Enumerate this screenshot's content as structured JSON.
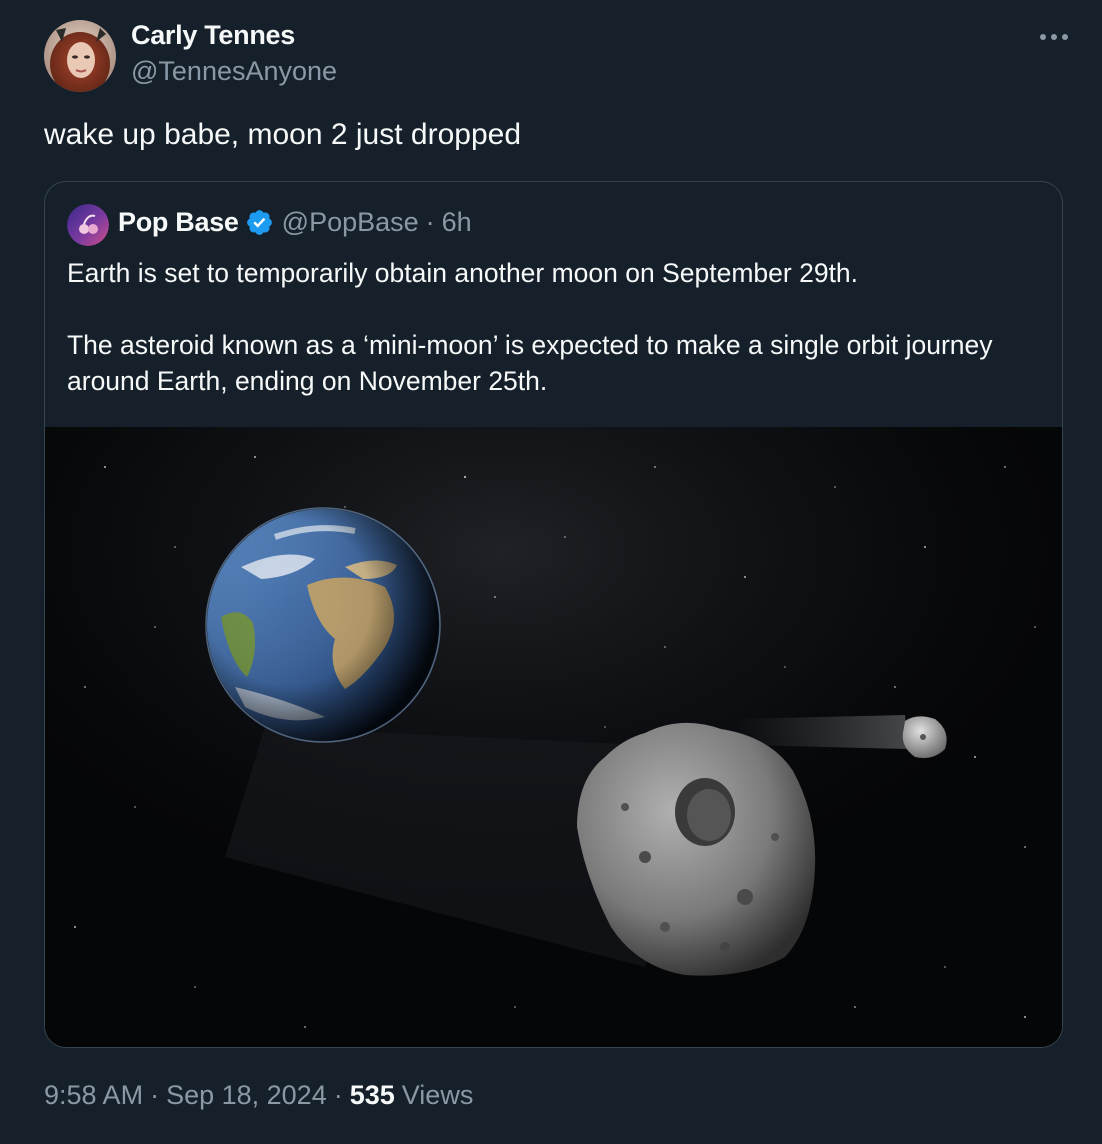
{
  "tweet": {
    "author_name": "Carly Tennes",
    "author_handle": "@TennesAnyone",
    "text": "wake up babe, moon 2 just dropped",
    "more_icon": "ellipsis-icon"
  },
  "quoted_tweet": {
    "author_name": "Pop Base",
    "author_handle": "@PopBase",
    "separator": "·",
    "time": "6h",
    "verified_icon": "verified-badge-icon",
    "paragraphs": [
      "Earth is set to temporarily obtain another moon on September 29th.",
      "The asteroid known as a ‘mini-moon’ is expected to make a single orbit journey around Earth, ending on November 25th."
    ],
    "image": {
      "subject": "earth-with-asteroids",
      "colors": {
        "space": "#050608",
        "ocean": "#2f5f9c",
        "land": "#b89d6b",
        "asteroid": "#8d8d8d"
      }
    }
  },
  "footer": {
    "time": "9:58 AM",
    "separator": "·",
    "date": "Sep 18, 2024",
    "views_count": "535",
    "views_label": "Views"
  },
  "theme": {
    "background": "#15202b",
    "text_primary": "#f7f9f9",
    "text_secondary": "#8b98a5",
    "border": "#38444d",
    "verified_blue": "#1d9bf0"
  }
}
